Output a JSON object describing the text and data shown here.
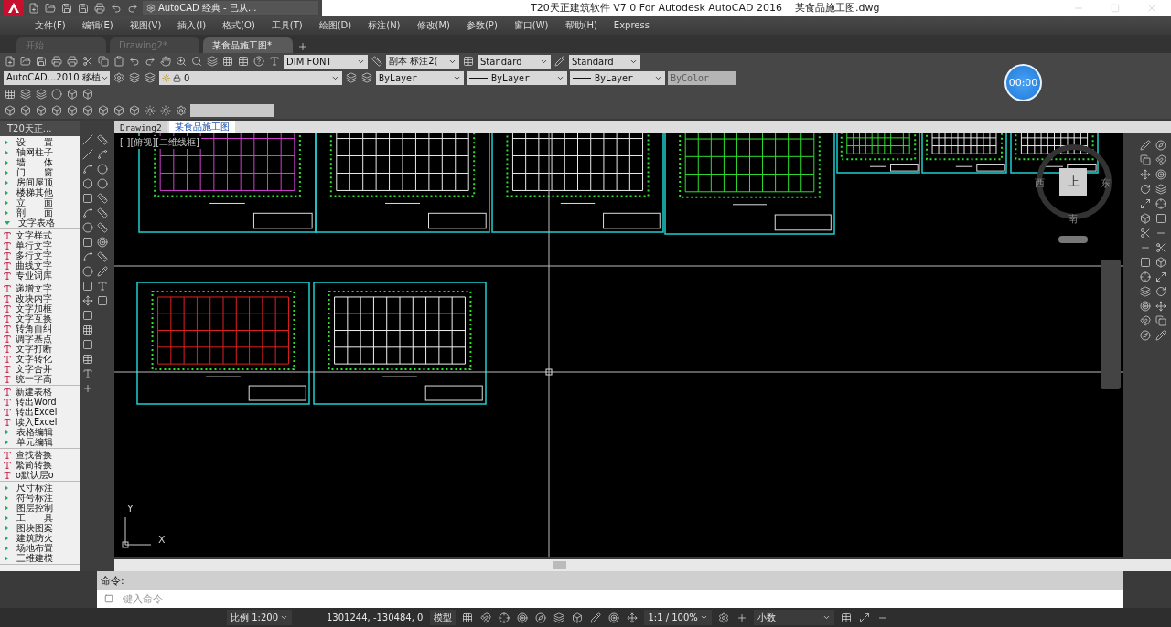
{
  "title_bar": {
    "workspace": "AutoCAD 经典 - 已从...",
    "title": [
      "T20天正建筑软件 V7.0 For Autodesk AutoCAD 2016",
      "某食品施工图.dwg"
    ]
  },
  "menu": [
    "文件(F)",
    "编辑(E)",
    "视图(V)",
    "插入(I)",
    "格式(O)",
    "工具(T)",
    "绘图(D)",
    "标注(N)",
    "修改(M)",
    "参数(P)",
    "窗口(W)",
    "帮助(H)",
    "Express"
  ],
  "doc_tabs": [
    {
      "label": "开始",
      "selected": false
    },
    {
      "label": "Drawing2*",
      "selected": false
    },
    {
      "label": "某食品施工图*",
      "selected": true
    }
  ],
  "toolbar": {
    "text_style": "DIM FONT",
    "dim_style": "副本 标注2(",
    "table_style": "Standard",
    "multileader_style": "Standard",
    "workspace": "AutoCAD...2010 移植",
    "layer": "0",
    "color_setting": "ByLayer",
    "linetype": "ByLayer",
    "lineweight": "ByLayer",
    "plot_style": {
      "value": "ByColor",
      "disabled": true
    }
  },
  "timer": "00:00",
  "tool_panel": {
    "title": "T20天正...",
    "groups": [
      {
        "items": [
          {
            "label": "设　　置",
            "kind": "folder",
            "expanded": false
          },
          {
            "label": "轴网柱子",
            "kind": "folder",
            "expanded": false
          },
          {
            "label": "墙　　体",
            "kind": "folder",
            "expanded": false
          },
          {
            "label": "门　　窗",
            "kind": "folder",
            "expanded": false
          },
          {
            "label": "房间屋顶",
            "kind": "folder",
            "expanded": false
          },
          {
            "label": "楼梯其他",
            "kind": "folder",
            "expanded": false
          },
          {
            "label": "立　　面",
            "kind": "folder",
            "expanded": false
          },
          {
            "label": "剖　　面",
            "kind": "folder",
            "expanded": false
          },
          {
            "label": "文字表格",
            "kind": "folder",
            "expanded": true
          }
        ]
      },
      {
        "items": [
          {
            "label": "文字样式",
            "kind": "command"
          },
          {
            "label": "单行文字",
            "kind": "command"
          },
          {
            "label": "多行文字",
            "kind": "command"
          },
          {
            "label": "曲线文字",
            "kind": "command"
          },
          {
            "label": "专业词库",
            "kind": "command"
          }
        ]
      },
      {
        "items": [
          {
            "label": "递增文字",
            "kind": "command"
          },
          {
            "label": "改块内字",
            "kind": "command"
          },
          {
            "label": "文字加框",
            "kind": "command"
          },
          {
            "label": "文字互换",
            "kind": "command"
          },
          {
            "label": "转角自纠",
            "kind": "command"
          },
          {
            "label": "调字基点",
            "kind": "command"
          },
          {
            "label": "文字打断",
            "kind": "command"
          },
          {
            "label": "文字转化",
            "kind": "command"
          },
          {
            "label": "文字合并",
            "kind": "command"
          },
          {
            "label": "统一字高",
            "kind": "command"
          }
        ]
      },
      {
        "items": [
          {
            "label": "新建表格",
            "kind": "command"
          },
          {
            "label": "转出Word",
            "kind": "command"
          },
          {
            "label": "转出Excel",
            "kind": "command"
          },
          {
            "label": "读入Excel",
            "kind": "command"
          },
          {
            "label": "表格编辑",
            "kind": "folder",
            "expanded": false
          },
          {
            "label": "单元编辑",
            "kind": "folder",
            "expanded": false
          }
        ]
      },
      {
        "items": [
          {
            "label": "查找替换",
            "kind": "command"
          },
          {
            "label": "繁简转换",
            "kind": "command"
          },
          {
            "label": "o默认层o",
            "kind": "command"
          }
        ]
      },
      {
        "items": [
          {
            "label": "尺寸标注",
            "kind": "folder",
            "expanded": false
          },
          {
            "label": "符号标注",
            "kind": "folder",
            "expanded": false
          },
          {
            "label": "图层控制",
            "kind": "folder",
            "expanded": false
          },
          {
            "label": "工　　具",
            "kind": "folder",
            "expanded": false
          },
          {
            "label": "图块图案",
            "kind": "folder",
            "expanded": false
          },
          {
            "label": "建筑防火",
            "kind": "folder",
            "expanded": false
          },
          {
            "label": "场地布置",
            "kind": "folder",
            "expanded": false
          },
          {
            "label": "三维建模",
            "kind": "folder",
            "expanded": false
          }
        ]
      }
    ]
  },
  "drawing_tabs": [
    {
      "label": "Drawing2",
      "selected": false
    },
    {
      "label": "某食品施工图",
      "selected": true
    }
  ],
  "viewport_label": "[-][俯视][二维线框]",
  "view_cube": {
    "top": "上",
    "west": "西",
    "east": "东",
    "south": "南"
  },
  "ucs": {
    "x": "X",
    "y": "Y"
  },
  "command": {
    "history": "命令:",
    "placeholder": "键入命令"
  },
  "status_bar": {
    "scale": "比例 1:200",
    "coordinates": "1301244, -130484, 0",
    "space": "模型",
    "annotation_scale": "1:1 / 100%",
    "units": "小数"
  }
}
